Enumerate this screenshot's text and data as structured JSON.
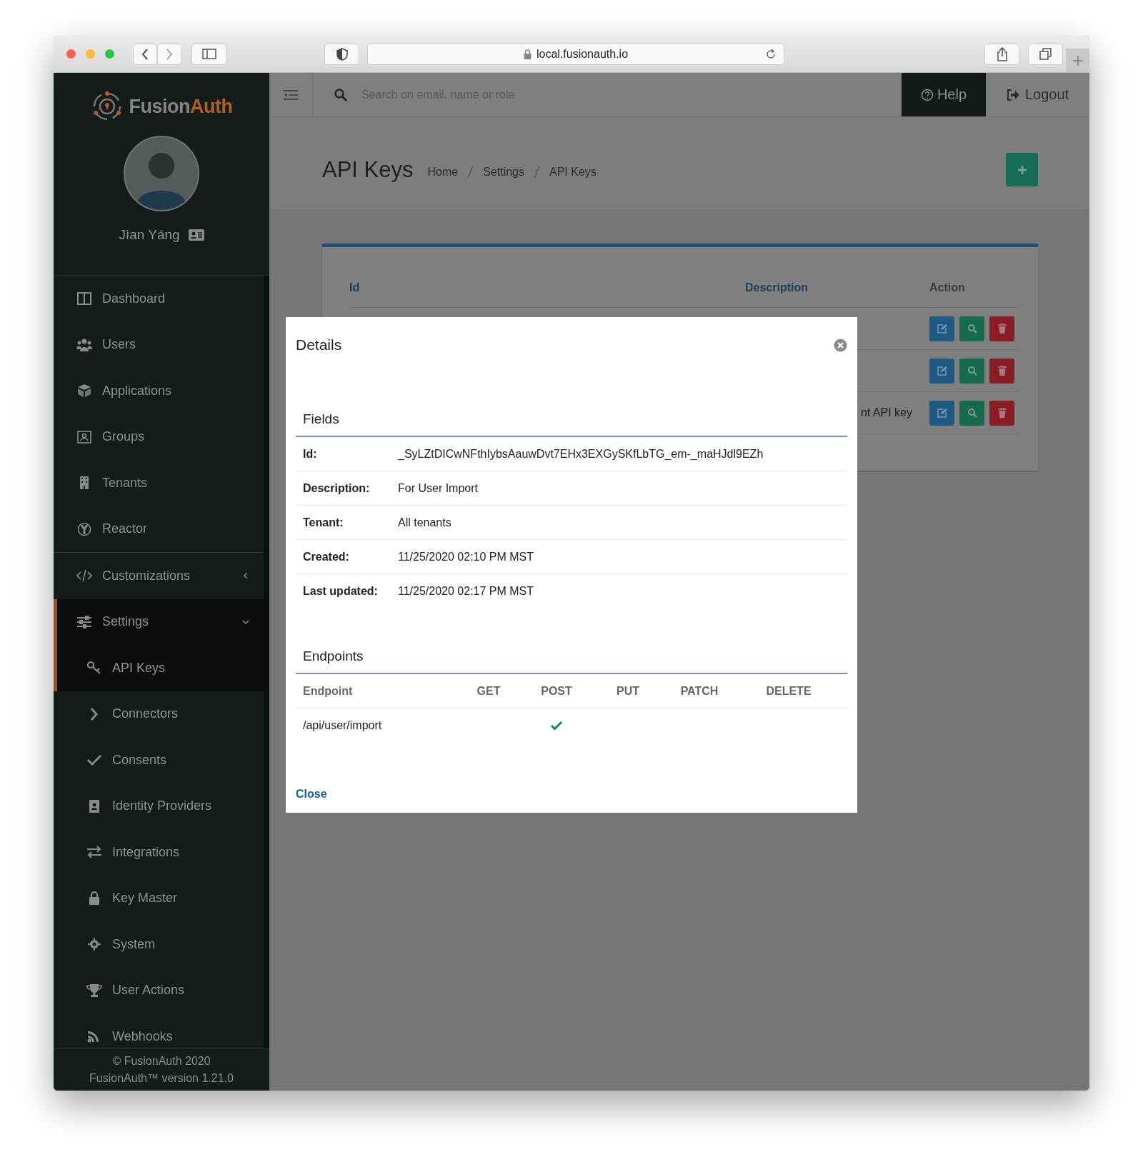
{
  "browser": {
    "url": "local.fusionauth.io"
  },
  "sidebar": {
    "logo": {
      "part_1": "Fusion",
      "part_2": "Auth"
    },
    "user": {
      "name": "Jìan Yáng"
    },
    "menu": [
      {
        "label": "Dashboard",
        "selected": false
      },
      {
        "label": "Users",
        "selected": false
      },
      {
        "label": "Applications",
        "selected": false
      },
      {
        "label": "Groups",
        "selected": false
      },
      {
        "label": "Tenants",
        "selected": false
      },
      {
        "label": "Reactor",
        "selected": false
      },
      {
        "label": "Customizations",
        "selected": false,
        "expanded": false
      },
      {
        "label": "Settings",
        "selected": true,
        "expanded": true,
        "children": [
          {
            "label": "API Keys",
            "selected": true
          },
          {
            "label": "Connectors",
            "selected": false
          },
          {
            "label": "Consents",
            "selected": false
          },
          {
            "label": "Identity Providers",
            "selected": false
          },
          {
            "label": "Integrations",
            "selected": false
          },
          {
            "label": "Key Master",
            "selected": false
          },
          {
            "label": "System",
            "selected": false
          },
          {
            "label": "User Actions",
            "selected": false
          },
          {
            "label": "Webhooks",
            "selected": false
          }
        ]
      }
    ],
    "footer": [
      "© FusionAuth 2020",
      "FusionAuth™ version 1.21.0"
    ]
  },
  "topbar": {
    "search": {
      "placeholder": "Search on email, name or role"
    },
    "help": "Help",
    "logout": "Logout"
  },
  "page": {
    "title": "API Keys",
    "breadcrumbs": [
      "Home",
      "Settings",
      "API Keys"
    ],
    "table": {
      "columns": [
        "Id",
        "Description",
        "Action"
      ],
      "rows": [
        {},
        {},
        {
          "description": "nt API key"
        }
      ]
    }
  },
  "modal": {
    "title": "Details",
    "fields": {
      "heading": "Fields",
      "rows": [
        {
          "label": "Id:",
          "value": "_SyLZtDICwNFthIybsAauwDvt7EHx3EXGySKfLbTG_em-_maHJdl9EZh"
        },
        {
          "label": "Description:",
          "value": "For User Import"
        },
        {
          "label": "Tenant:",
          "value": "All tenants"
        },
        {
          "label": "Created:",
          "value": "11/25/2020 02:10 PM MST"
        },
        {
          "label": "Last updated:",
          "value": "11/25/2020 02:17 PM MST"
        }
      ]
    },
    "endpoints": {
      "heading": "Endpoints",
      "columns": [
        "Endpoint",
        "GET",
        "POST",
        "PUT",
        "PATCH",
        "DELETE"
      ],
      "rows": [
        {
          "endpoint": "/api/user/import",
          "methods": [
            false,
            true,
            false,
            false,
            false
          ]
        }
      ]
    },
    "close": "Close"
  }
}
